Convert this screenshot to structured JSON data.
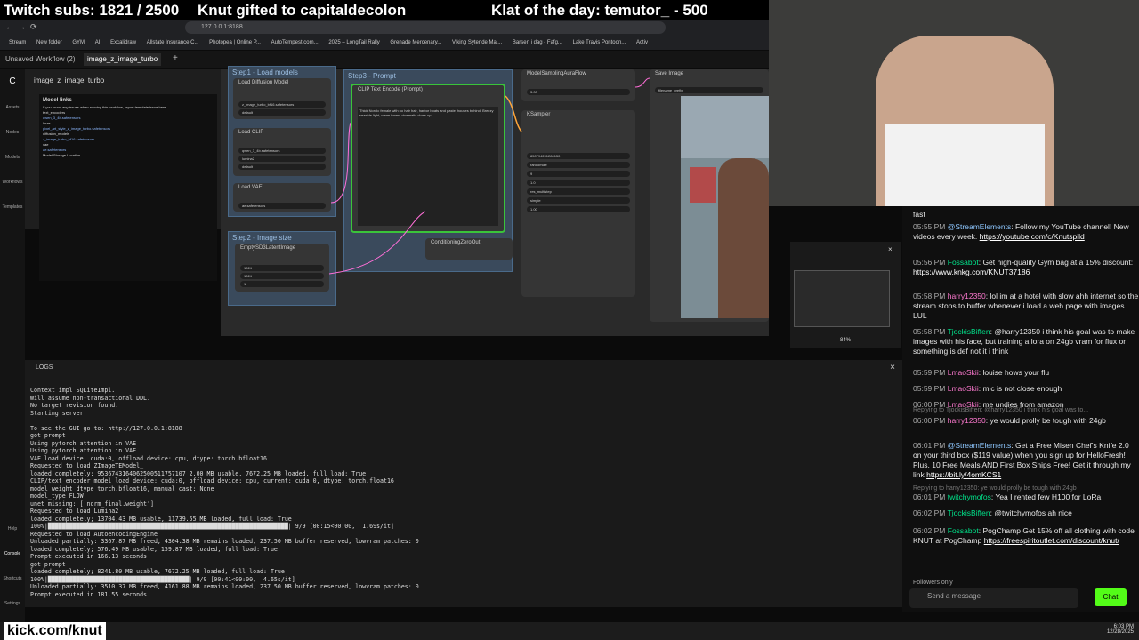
{
  "overlay": {
    "subs": "Twitch subs: 1821 / 2500",
    "gift": "Knut gifted to capitaldecolon",
    "klat": "Klat of the day: temutor_ - 500"
  },
  "browser": {
    "url": "127.0.0.1:8188",
    "bookmarks": [
      "Stream",
      "New folder",
      "GYM",
      "AI",
      "Excalidraw",
      "Allstate Insurance C...",
      "Photopea | Online P...",
      "AutoTempest.com...",
      "2025 – LongTail Rally",
      "Grenade Mercenary...",
      "Viking Sytende Mal...",
      "Barsen i dag - Fafg...",
      "Lake Travis Pontoon...",
      "Activ"
    ],
    "tabs": [
      "Unsaved Workflow (2)",
      "image_z_image_turbo"
    ]
  },
  "sidebar": {
    "items": [
      "Assets",
      "Nodes",
      "Models",
      "Workflows",
      "Templates",
      "Help",
      "Console",
      "Shortcuts",
      "Settings"
    ]
  },
  "workflow_panel": {
    "title": "image_z_image_turbo",
    "heading": "Model links",
    "lines": [
      "If you found any issues when running this workflow, report template issue here",
      "text_encoders",
      "qwen_3_4b.safetensors",
      "loras",
      "pixel_art_style_z_image_turbo.safetensors",
      "diffusion_models",
      "z_image_turbo_bf16.safetensors",
      "vae",
      "ae.safetensors",
      "Model Storage Location"
    ]
  },
  "canvas": {
    "groups": [
      "Step1 - Load models",
      "Step2 - Image size",
      "Step3 - Prompt"
    ],
    "nodes": {
      "load_diffusion": "Load Diffusion Model",
      "load_clip": "Load CLIP",
      "load_vae": "Load VAE",
      "clip_text_encode": "CLIP Text Encode (Prompt)",
      "model_sampling": "ModelSamplingAuraFlow",
      "ksampler": "KSampler",
      "save_image": "Save Image",
      "empty_latent": "EmptySD3LatentImage",
      "conditioning_zero": "ConditioningZeroOut"
    },
    "widgets": {
      "unet_name": "z_image_turbo_bf16.safetensors",
      "weight_dtype": "default",
      "clip_name": "qwen_3_4b.safetensors",
      "clip_type": "lumina2",
      "device": "default",
      "vae_name": "ae.safetensors",
      "width": "1024",
      "height": "1024",
      "batch_size": "1",
      "shift": "3.00",
      "seed": "850794201280150",
      "control_after_generate": "randomize",
      "steps": "9",
      "cfg": "1.0",
      "sampler_name": "res_multistep",
      "scheduler": "simple",
      "denoise": "1.00",
      "filename_prefix": "filename_prefix"
    },
    "prompt": "Thick Nordic female with no hair hair, harbor boats and pastel houses behind. Breezy seaside light, warm tones, cinematic close-up.",
    "zoom": "84%"
  },
  "logs": {
    "title": "LOGS",
    "lines": [
      "Context impl SQLiteImpl.",
      "Will assume non-transactional DDL.",
      "No target revision found.",
      "Starting server",
      "",
      "To see the GUI go to: http://127.0.0.1:8188",
      "got prompt",
      "Using pytorch attention in VAE",
      "Using pytorch attention in VAE",
      "VAE load device: cuda:0, offload device: cpu, dtype: torch.bfloat16",
      "Requested to load ZImageTEModel_",
      "loaded completely; 9536743164062500511757107 2.00 MB usable, 7672.25 MB loaded, full load: True",
      "CLIP/text encoder model load device: cuda:0, offload device: cpu, current: cuda:0, dtype: torch.float16",
      "model weight dtype torch.bfloat16, manual cast: None",
      "model_type FLOW",
      "unet missing: ['norm_final.weight']",
      "Requested to load Lumina2",
      "loaded completely; 13704.43 MB usable, 11739.55 MB loaded, full load: True",
      "100%|████████████████████████████████████████████████████████████████████| 9/9 [00:15<00:00,  1.69s/it]",
      "Requested to load AutoencodingEngine",
      "Unloaded partially: 3367.87 MB freed, 4304.38 MB remains loaded, 237.50 MB buffer reserved, lowvram patches: 0",
      "loaded completely; 576.49 MB usable, 159.87 MB loaded, full load: True",
      "Prompt executed in 166.13 seconds",
      "got prompt",
      "loaded completely; 8241.80 MB usable, 7672.25 MB loaded, full load: True",
      "100%|████████████████████████████████████████| 9/9 [00:41<00:00,  4.65s/it]",
      "Unloaded partially: 3510.37 MB freed, 4161.88 MB remains loaded, 237.50 MB buffer reserved, lowvram patches: 0",
      "Prompt executed in 181.55 seconds"
    ]
  },
  "chat": {
    "first": "fast",
    "messages": [
      {
        "time": "05:55 PM",
        "user": "@StreamElements",
        "text": ": Follow my YouTube channel! New videos every week.",
        "link": "https://youtube.com/c/Knutspild",
        "cls": "u3"
      },
      {
        "time": "05:56 PM",
        "user": "Fossabot",
        "text": ": Get high-quality Gym bag at a 15% discount:",
        "link": "https://www.knkg.com/KNUT37186",
        "cls": "u2"
      },
      {
        "time": "05:58 PM",
        "user": "harry12350",
        "text": ": lol im at a hotel with slow ahh internet so the stream stops to buffer whenever i load a web page with images LUL",
        "link": "",
        "cls": "u1"
      },
      {
        "time": "05:58 PM",
        "user": "TjockisBiffen",
        "text": ": @harry12350 i think his goal was to make images with his face, but training a lora on 24gb vram for flux or something is def not it i think",
        "link": "",
        "cls": "u2"
      },
      {
        "time": "05:59 PM",
        "user": "LmaoSkii",
        "text": ": louise hows your flu",
        "link": "",
        "cls": "u1"
      },
      {
        "time": "05:59 PM",
        "user": "LmaoSkii",
        "text": ": mic is not close enough",
        "link": "",
        "cls": "u1"
      },
      {
        "time": "06:00 PM",
        "user": "LmaoSkii",
        "text": ": me undies from amazon",
        "link": "",
        "cls": "u1"
      },
      {
        "time": "06:00 PM",
        "user": "harry12350",
        "text": ": ye would prolly be tough with 24gb",
        "link": "",
        "cls": "u1"
      },
      {
        "time": "06:01 PM",
        "user": "@StreamElements",
        "text": ": Get a Free Misen Chef's Knife 2.0 on your third box ($119 value) when you sign up for HelloFresh! Plus, 10 Free Meals AND First Box Ships Free! Get it through my link",
        "link": "https://bit.ly/4omKCS1",
        "cls": "u3"
      },
      {
        "time": "06:01 PM",
        "user": "twitchymofos",
        "text": ": Yea I rented few H100 for LoRa",
        "link": "",
        "cls": "u2"
      },
      {
        "time": "06:02 PM",
        "user": "TjockisBiffen",
        "text": ": @twitchymofos ah nice",
        "link": "",
        "cls": "u2"
      },
      {
        "time": "06:02 PM",
        "user": "Fossabot",
        "text": ": PogChamp Get 15% off all clothing with code KNUT at PogChamp",
        "link": "https://freespiritoutlet.com/discount/knut/",
        "cls": "u2"
      }
    ],
    "reply1": "Replying to TjockisBiffen: @harry12350 i think his goal was to...",
    "reply2": "Replying to harry12350: ye would prolly be tough with 24gb",
    "followers": "Followers only",
    "placeholder": "Send a message",
    "chat_button": "Chat"
  },
  "watermark": "kick.com/knut",
  "clock": {
    "time": "6:03 PM",
    "date": "12/28/2025"
  }
}
